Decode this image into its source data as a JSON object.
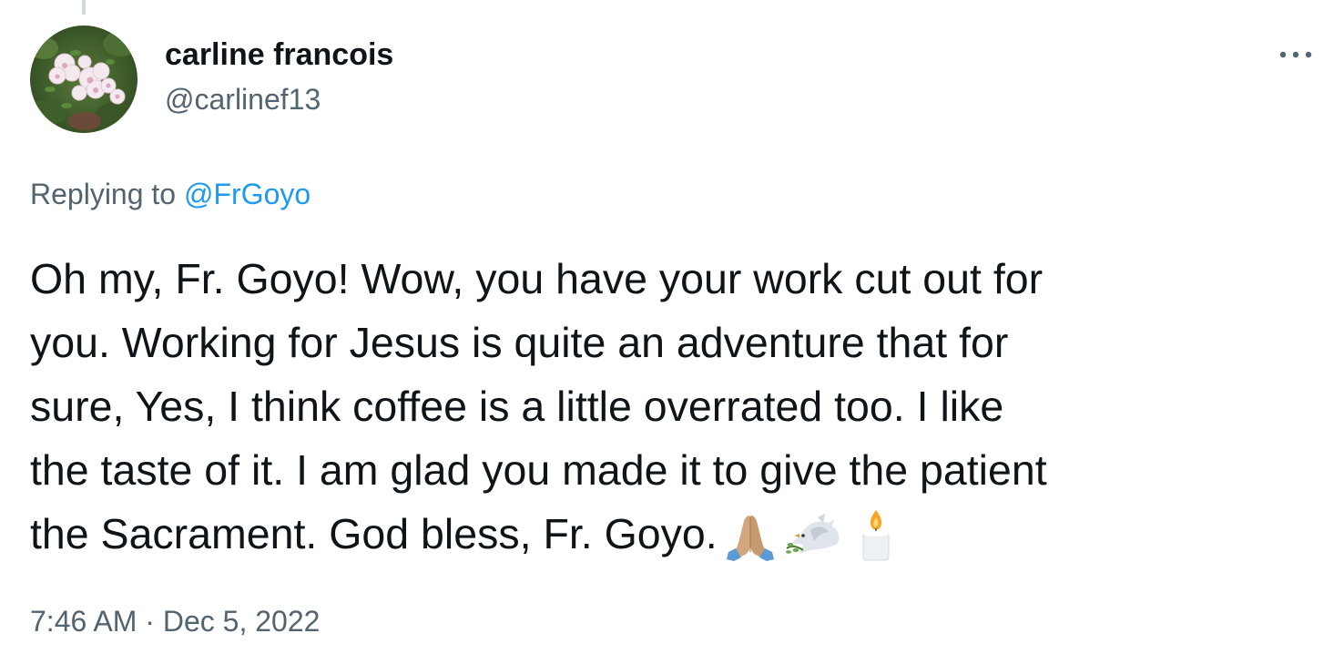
{
  "tweet": {
    "author": {
      "display_name": "carline francois",
      "handle": "@carlinef13",
      "avatar_icon": "flower-photo-avatar"
    },
    "reply_context": {
      "prefix": "Replying to",
      "mention": "@FrGoyo"
    },
    "body_lines": [
      "Oh my, Fr. Goyo! Wow, you have your work cut out for",
      "you. Working for Jesus is quite an adventure that for",
      "sure, Yes, I think coffee is a little overrated too. I like",
      "the taste of it. I am glad you made it to give the patient",
      "the Sacrament. God bless, Fr. Goyo."
    ],
    "emojis": [
      "folded-hands-emoji",
      "dove-emoji",
      "candle-emoji"
    ],
    "timestamp": {
      "time": "7:46 AM",
      "separator": "·",
      "date": "Dec 5, 2022"
    },
    "more_icon": "more-options-icon"
  },
  "colors": {
    "text_primary": "#0f1419",
    "text_secondary": "#536471",
    "link": "#1d9bf0",
    "thread_line": "#cfd9de"
  }
}
